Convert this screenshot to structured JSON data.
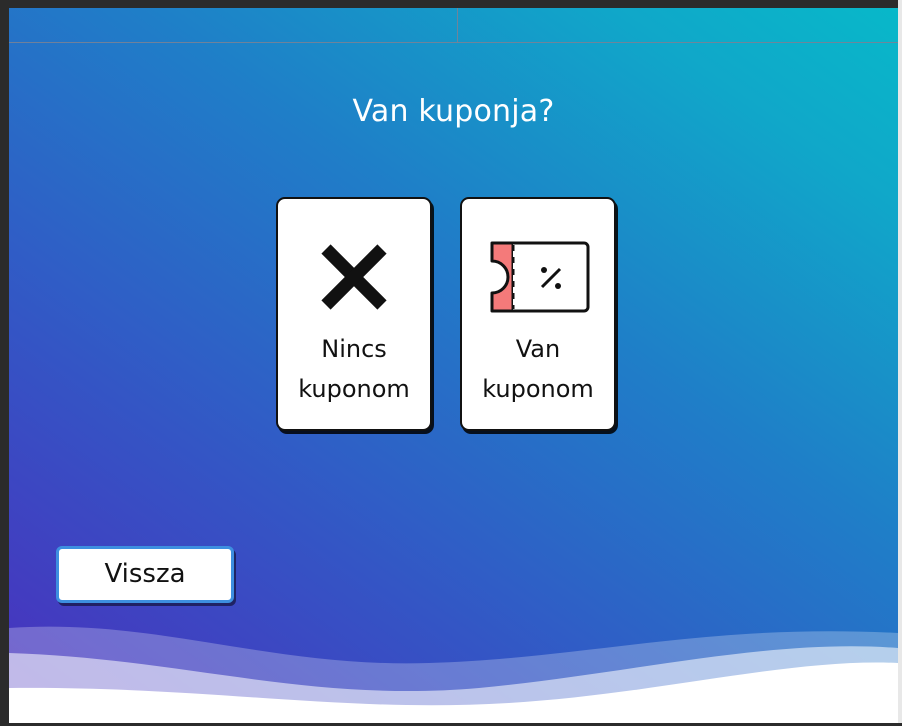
{
  "page": {
    "title": "Van kuponja?"
  },
  "options": [
    {
      "label_line1": "Nincs",
      "label_line2": "kuponom",
      "icon": "close-x-icon"
    },
    {
      "label_line1": "Van",
      "label_line2": "kuponom",
      "icon": "coupon-ticket-icon"
    }
  ],
  "back_button": {
    "label": "Vissza"
  },
  "colors": {
    "gradient_start": "#4a2fbd",
    "gradient_end": "#08b8c9",
    "coupon_stub": "#f47a7a",
    "button_border": "#3d8fe0"
  }
}
